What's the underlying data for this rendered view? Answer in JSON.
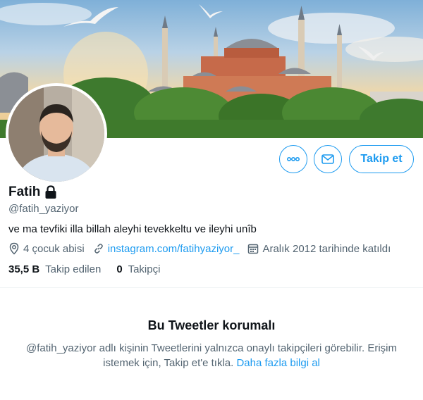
{
  "profile": {
    "name": "Fatih",
    "handle": "@fatih_yaziyor",
    "bio": "ve ma tevfiki illa billah aleyhi tevekkeltu ve ileyhi unîb",
    "location": "4 çocuk abisi",
    "website": "instagram.com/fatihyaziyor_",
    "joined": "Aralık 2012 tarihinde katıldı",
    "protected": true
  },
  "actions": {
    "follow_label": "Takip et",
    "more_icon": "more-icon",
    "message_icon": "mail-icon"
  },
  "stats": {
    "following_count": "35,5 B",
    "following_label": "Takip edilen",
    "followers_count": "0",
    "followers_label": "Takipçi"
  },
  "protected_notice": {
    "title": "Bu Tweetler korumalı",
    "text": "@fatih_yaziyor adlı kişinin Tweetlerini yalnızca onaylı takipçileri görebilir. Erişim istemek için, Takip et'e tıkla.",
    "link": "Daha fazla bilgi al"
  },
  "colors": {
    "accent": "#1d9bf0",
    "secondary_text": "#536471",
    "primary_text": "#0f1419"
  }
}
